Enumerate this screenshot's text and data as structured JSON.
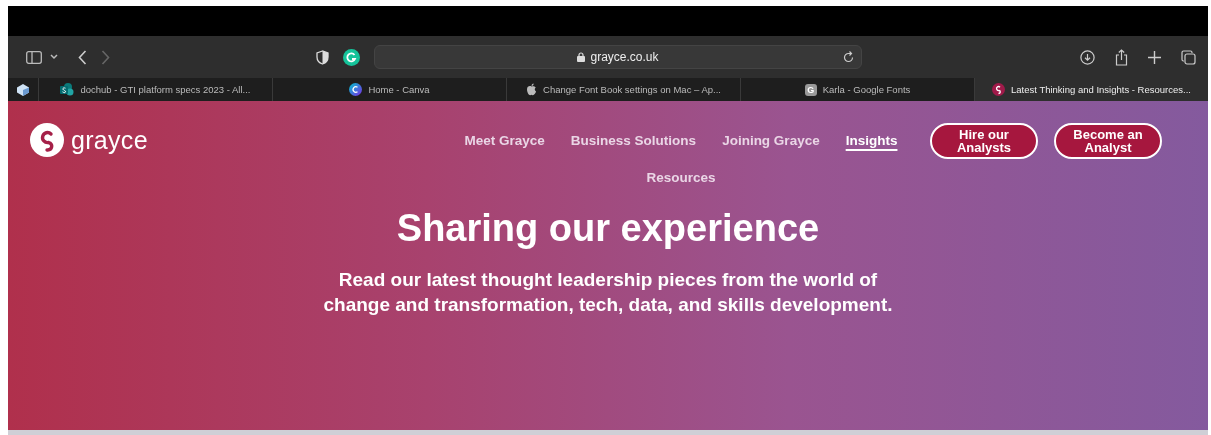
{
  "browser": {
    "address": "grayce.co.uk"
  },
  "tabs": [
    {
      "title": "dochub - GTI platform specs 2023 - All...",
      "selected": false,
      "kind": "sharepoint"
    },
    {
      "title": "Home - Canva",
      "selected": false,
      "kind": "canva"
    },
    {
      "title": "Change Font Book settings on Mac – Ap...",
      "selected": false,
      "kind": "apple"
    },
    {
      "title": "Karla - Google Fonts",
      "selected": false,
      "kind": "letter",
      "icon_letter": "G"
    },
    {
      "title": "Latest Thinking and Insights - Resources...",
      "selected": true,
      "kind": "grayce"
    }
  ],
  "site": {
    "logo_text": "grayce",
    "nav": [
      {
        "label": "Meet Grayce",
        "selected": false
      },
      {
        "label": "Business Solutions",
        "selected": false
      },
      {
        "label": "Joining Grayce",
        "selected": false
      },
      {
        "label": "Insights",
        "selected": true
      },
      {
        "label": "Resources",
        "selected": false
      }
    ],
    "buttons": [
      "Hire our Analysts",
      "Become an Analyst"
    ]
  },
  "hero": {
    "title": "Sharing our experience",
    "subtitle": "Read our latest thought leadership pieces from the world of change and transformation, tech, data, and skills development."
  }
}
